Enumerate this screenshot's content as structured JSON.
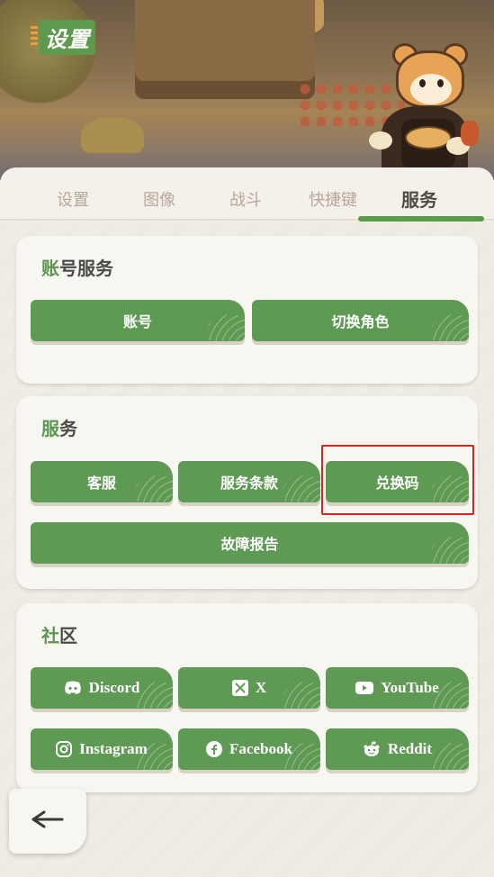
{
  "header": {
    "title": "设置"
  },
  "tabs": [
    {
      "label": "设置"
    },
    {
      "label": "图像"
    },
    {
      "label": "战斗"
    },
    {
      "label": "快捷键"
    },
    {
      "label": "服务",
      "active": true
    }
  ],
  "sections": {
    "account": {
      "title_accent": "账",
      "title_rest": "号服务",
      "buttons": [
        {
          "label": "账号"
        },
        {
          "label": "切换角色"
        }
      ]
    },
    "service": {
      "title_accent": "服",
      "title_rest": "务",
      "buttons": [
        {
          "label": "客服"
        },
        {
          "label": "服务条款"
        },
        {
          "label": "兑换码"
        },
        {
          "label": "故障报告"
        }
      ]
    },
    "community": {
      "title_accent": "社",
      "title_rest": "区",
      "buttons": [
        {
          "label": "Discord",
          "icon": "discord-icon"
        },
        {
          "label": "X",
          "icon": "x-icon"
        },
        {
          "label": "YouTube",
          "icon": "youtube-icon"
        },
        {
          "label": "Instagram",
          "icon": "instagram-icon"
        },
        {
          "label": "Facebook",
          "icon": "facebook-icon"
        },
        {
          "label": "Reddit",
          "icon": "reddit-icon"
        }
      ]
    }
  },
  "back_button": {
    "icon": "back-arrow-icon"
  },
  "colors": {
    "accent_green": "#5f9a55",
    "highlight": "#e02020",
    "panel": "#f8f6f1"
  }
}
